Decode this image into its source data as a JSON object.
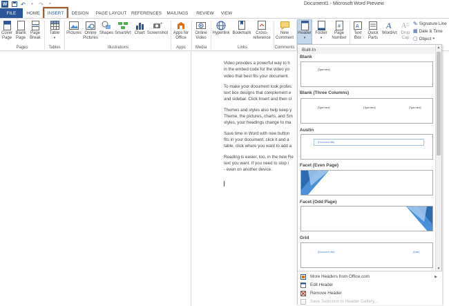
{
  "window": {
    "title": "Document1 - Microsoft Word Preview"
  },
  "qat": {
    "save_icon": "save-icon",
    "undo_icon": "undo-icon",
    "redo_icon": "redo-icon"
  },
  "tabs": [
    {
      "label": "FILE"
    },
    {
      "label": "HOME"
    },
    {
      "label": "INSERT"
    },
    {
      "label": "DESIGN"
    },
    {
      "label": "PAGE LAYOUT"
    },
    {
      "label": "REFERENCES"
    },
    {
      "label": "MAILINGS"
    },
    {
      "label": "REVIEW"
    },
    {
      "label": "VIEW"
    }
  ],
  "ribbon": {
    "pages": {
      "label": "Pages",
      "cover_page": "Cover Page",
      "blank_page": "Blank Page",
      "page_break": "Page Break"
    },
    "tables": {
      "label": "Tables",
      "table": "Table"
    },
    "illustrations": {
      "label": "Illustrations",
      "pictures": "Pictures",
      "online_pictures": "Online Pictures",
      "shapes": "Shapes",
      "smartart": "SmartArt",
      "chart": "Chart",
      "screenshot": "Screenshot"
    },
    "apps": {
      "label": "Apps",
      "apps_for_office": "Apps for Office"
    },
    "media": {
      "label": "Media",
      "online_video": "Online Video"
    },
    "links": {
      "label": "Links",
      "hyperlink": "Hyperlink",
      "bookmark": "Bookmark",
      "cross_reference": "Cross-reference"
    },
    "comments": {
      "label": "Comments",
      "new_comment": "New Comment"
    },
    "header_footer": {
      "header": "Header",
      "footer": "Footer",
      "page_number": "Page Number"
    },
    "text": {
      "text_box": "Text Box",
      "quick_parts": "Quick Parts",
      "wordart": "WordArt",
      "drop_cap": "Drop Cap",
      "signature_line": "Signature Line",
      "date_time": "Date & Time",
      "object": "Object"
    }
  },
  "document": {
    "paragraphs": [
      "Video provides a powerful way to h",
      "in the embed code for the video yo",
      "video that best fits your document.",
      "To make your document look profes",
      "text box designs that complement e",
      "and sidebar. Click Insert and then cl",
      "Themes and styles also help keep y",
      "Theme, the pictures, charts, and Sm",
      "styles, your headings change to ma",
      "Save time in Word with new button",
      "fits in your document, click it and a",
      "table, click where you want to add a",
      "Reading is easier, too, in the new Re",
      "text you want. If you need to stop r",
      "- even on another device."
    ]
  },
  "gallery": {
    "section": "Built-In",
    "items": [
      {
        "label": "Blank",
        "placeholders": [
          "[Type here]"
        ]
      },
      {
        "label": "Blank (Three Columns)",
        "placeholders": [
          "[Type here]",
          "[Type here]",
          "[Type here]"
        ]
      },
      {
        "label": "Austin",
        "placeholders": [
          "[Document title]"
        ]
      },
      {
        "label": "Facet (Even Page)",
        "placeholders": []
      },
      {
        "label": "Facet (Odd Page)",
        "placeholders": []
      },
      {
        "label": "Grid",
        "placeholders": [
          "[Document title]",
          "[Date]"
        ]
      }
    ],
    "menu": [
      {
        "label": "More Headers from Office.com",
        "icon": "office-icon",
        "enabled": true,
        "submenu": true
      },
      {
        "label": "Edit Header",
        "icon": "edit-header-icon",
        "enabled": true,
        "submenu": false
      },
      {
        "label": "Remove Header",
        "icon": "remove-header-icon",
        "enabled": true,
        "submenu": false
      },
      {
        "label": "Save Selection to Header Gallery...",
        "icon": "save-gallery-icon",
        "enabled": false,
        "submenu": false
      }
    ]
  },
  "colors": {
    "accent": "#2b579a",
    "highlight_border": "#a55d35",
    "facet_blue": "#4a90d9"
  }
}
